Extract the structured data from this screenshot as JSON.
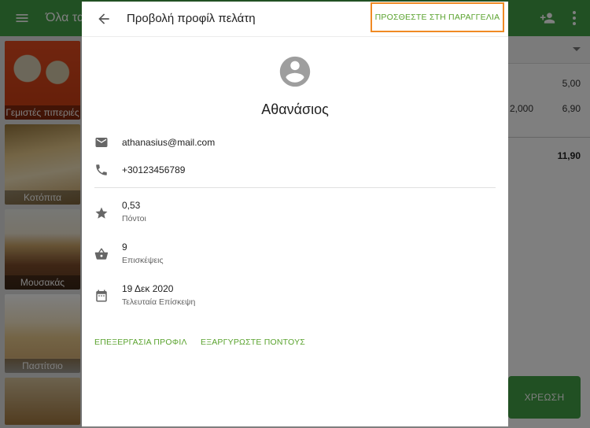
{
  "app": {
    "category_title": "Όλα τα",
    "products": [
      {
        "label": "Γεμιστές πιπεριές"
      },
      {
        "label": "Κοτόπιτα"
      },
      {
        "label": "Μουσακάς"
      },
      {
        "label": "Παστίτσιο"
      }
    ],
    "order": {
      "lines": [
        {
          "qty": "",
          "price": "5,00"
        },
        {
          "qty": "2,000",
          "price": "6,90"
        }
      ],
      "total": "11,90",
      "charge_label": "ΧΡΕΩΣΗ"
    }
  },
  "dialog": {
    "title": "Προβολή προφίλ πελάτη",
    "add_to_order": "ΠΡΟΣΘΕΣΤΕ ΣΤΗ ΠΑΡΑΓΓΕΛΙΑ",
    "customer_name": "Αθανάσιος",
    "email": "athanasius@mail.com",
    "phone": "+30123456789",
    "points": {
      "value": "0,53",
      "label": "Πόντοι"
    },
    "visits": {
      "value": "9",
      "label": "Επισκέψεις"
    },
    "last_visit": {
      "value": "19 Δεκ 2020",
      "label": "Τελευταία Επίσκεψη"
    },
    "edit_profile": "ΕΠΕΞΕΡΓΑΣΙΑ ΠΡΟΦΙΛ",
    "redeem_points": "ΕΞΑΡΓΥΡΩΣΤΕ ΠΟΝΤΟΥΣ"
  },
  "colors": {
    "accent": "#43a047",
    "link": "#5aa32e",
    "highlight": "#f08a24"
  }
}
